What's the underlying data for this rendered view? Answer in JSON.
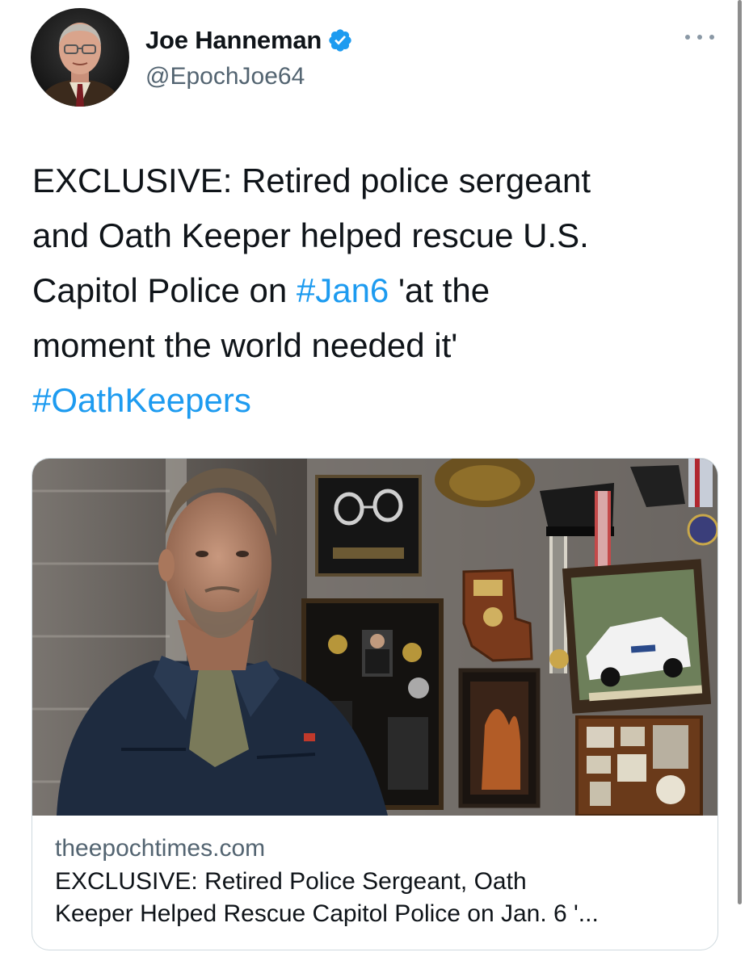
{
  "author": {
    "display_name": "Joe Hanneman",
    "handle": "@EpochJoe64",
    "verified": true,
    "avatar_icon": "profile-photo"
  },
  "tweet": {
    "lines": [
      {
        "parts": [
          {
            "text": "EXCLUSIVE: Retired police sergeant",
            "hashtag": false
          }
        ]
      },
      {
        "parts": [
          {
            "text": "and Oath Keeper helped rescue U.S.",
            "hashtag": false
          }
        ]
      },
      {
        "parts": [
          {
            "text": "Capitol Police on ",
            "hashtag": false
          },
          {
            "text": "#Jan6",
            "hashtag": true
          },
          {
            "text": " 'at the",
            "hashtag": false
          }
        ]
      },
      {
        "parts": [
          {
            "text": "moment the world needed it'",
            "hashtag": false
          }
        ]
      },
      {
        "parts": [
          {
            "text": "#OathKeepers",
            "hashtag": true
          }
        ]
      }
    ]
  },
  "link_card": {
    "domain": "theepochtimes.com",
    "title_line1": "EXCLUSIVE: Retired Police Sergeant, Oath",
    "title_line2": "Keeper Helped Rescue Capitol Police on Jan. 6 '...",
    "image_icon": "article-photo"
  },
  "colors": {
    "link": "#1d9bf0",
    "text": "#0f1419",
    "secondary": "#536471",
    "border": "#cfd9de"
  },
  "icons": {
    "verified": "verified-badge-icon",
    "more": "more-options-icon"
  }
}
